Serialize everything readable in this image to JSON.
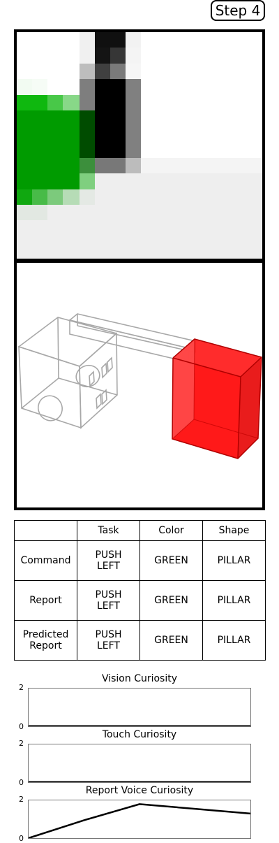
{
  "step": {
    "label": "Step 4"
  },
  "table": {
    "headers": [
      "",
      "Task",
      "Color",
      "Shape"
    ],
    "rows": [
      {
        "label": "Command",
        "task": "PUSH\nLEFT",
        "color": "GREEN",
        "shape": "PILLAR"
      },
      {
        "label": "Report",
        "task": "PUSH\nLEFT",
        "color": "GREEN",
        "shape": "PILLAR"
      },
      {
        "label": "Predicted\nReport",
        "task": "PUSH\nLEFT",
        "color": "GREEN",
        "shape": "PILLAR"
      }
    ]
  },
  "charts": {
    "vision": {
      "title": "Vision Curiosity",
      "y_max": "2",
      "y_min": "0"
    },
    "touch": {
      "title": "Touch Curiosity",
      "y_max": "2",
      "y_min": "0"
    },
    "voice": {
      "title": "Report Voice Curiosity",
      "y_max": "2",
      "y_min": "0"
    }
  },
  "chart_data": [
    {
      "type": "line",
      "title": "Vision Curiosity",
      "ylim": [
        0,
        2
      ],
      "values": []
    },
    {
      "type": "line",
      "title": "Touch Curiosity",
      "ylim": [
        0,
        2
      ],
      "values": []
    },
    {
      "type": "line",
      "title": "Report Voice Curiosity",
      "ylim": [
        0,
        2
      ],
      "x": [
        0,
        1,
        2,
        3,
        4
      ],
      "values": [
        0,
        0.95,
        1.8,
        1.55,
        1.3
      ]
    }
  ],
  "colors": {
    "object": "#ff1a1a",
    "vision_green": "#009b00"
  }
}
